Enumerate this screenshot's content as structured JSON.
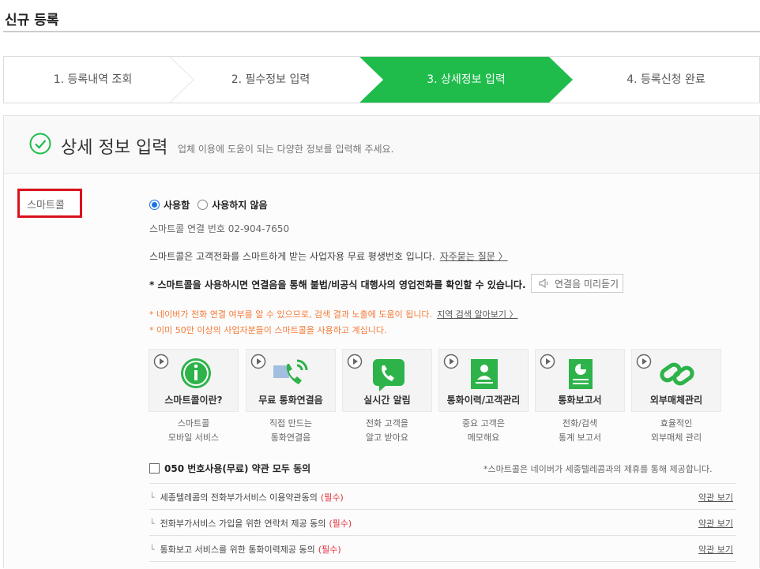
{
  "page_title": "신규 등록",
  "steps": [
    {
      "label": "1. 등록내역 조회",
      "active": false
    },
    {
      "label": "2. 필수정보 입력",
      "active": false
    },
    {
      "label": "3. 상세정보 입력",
      "active": true
    },
    {
      "label": "4. 등록신청 완료",
      "active": false
    }
  ],
  "colors": {
    "active_step": "#1fbc4c",
    "highlight_border": "#d9121b",
    "required": "#e0303a",
    "notice": "#f47b38"
  },
  "section": {
    "title": "상세 정보 입력",
    "description": "업체 이용에 도움이 되는 다양한 정보를 입력해 주세요."
  },
  "smartcall": {
    "label": "스마트콜",
    "options": [
      {
        "label": "사용함",
        "selected": true
      },
      {
        "label": "사용하지 않음",
        "selected": false
      }
    ],
    "connect_number": "스마트콜 연결 번호 02-904-7650",
    "intro": "스마트콜은 고객전화를 스마트하게 받는 사업자용 무료 평생번호 입니다.",
    "faq_link": "자주묻는 질문 〉",
    "warning": "* 스마트콜을 사용하시면 연결음을 통해 불법/비공식 대행사의 영업전화를 확인할 수 있습니다.",
    "listen_button": "연결음 미리듣기",
    "notice1": "* 네이버가 전화 연결 여부를 알 수 있으므로, 검색 결과 노출에 도움이 됩니다.",
    "notice1_link": "지역 검색 알아보기 〉",
    "notice2": "* 이미 50만 이상의 사업자분들이 스마트콜을 사용하고 계십니다.",
    "cards": [
      {
        "title": "스마트콜이란?",
        "caption1": "스마트콜",
        "caption2": "모바일 서비스",
        "icon": "info-icon"
      },
      {
        "title": "무료 통화연결음",
        "caption1": "직접 만드는",
        "caption2": "통화연결음",
        "icon": "phone-ring-icon"
      },
      {
        "title": "실시간 알림",
        "caption1": "전화 고객을",
        "caption2": "알고 받아요",
        "icon": "phone-chat-icon"
      },
      {
        "title": "통화이력/고객관리",
        "caption1": "중요 고객은",
        "caption2": "메모해요",
        "icon": "contact-card-icon"
      },
      {
        "title": "통화보고서",
        "caption1": "전화/검색",
        "caption2": "통계 보고서",
        "icon": "report-icon"
      },
      {
        "title": "외부매체관리",
        "caption1": "효율적인",
        "caption2": "외부매체 관리",
        "icon": "link-icon"
      }
    ],
    "agree_all": "050 번호사용(무료) 약관 모두 동의",
    "agree_note": "*스마트콜은 네이버가 세종텔레콤과의 제휴를 통해 제공합니다.",
    "terms": [
      {
        "label": "세종텔레콤의 전화부가서비스 이용약관동의",
        "required": "(필수)",
        "view": "약관 보기"
      },
      {
        "label": "전화부가서비스 가입을 위한 연락처 제공 동의",
        "required": "(필수)",
        "view": "약관 보기"
      },
      {
        "label": "통화보고 서비스를 위한 통화이력제공 동의",
        "required": "(필수)",
        "view": "약관 보기"
      }
    ]
  }
}
